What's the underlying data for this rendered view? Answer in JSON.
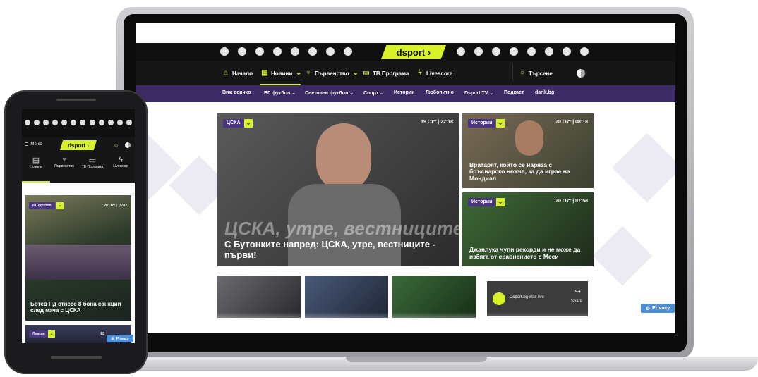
{
  "site": {
    "brand": "dsport",
    "nav": [
      {
        "label": "Начало",
        "icon": "home-icon"
      },
      {
        "label": "Новини",
        "icon": "news-icon"
      },
      {
        "label": "Първенство",
        "icon": "trophy-icon"
      },
      {
        "label": "ТВ Програма",
        "icon": "tv-icon"
      },
      {
        "label": "Livescore",
        "icon": "bolt-icon"
      }
    ],
    "search_label": "Търсене",
    "subnav": [
      "Виж всичко",
      "БГ футбол ⌄",
      "Световен футбол ⌄",
      "Спорт ⌄",
      "Истории",
      "Любопитно",
      "Dsport TV ⌄",
      "Подкаст",
      "darik.bg"
    ],
    "hero": {
      "tag": "ЦСКА",
      "date": "19 Окт | 22:18",
      "title": "С Бутонките напред: ЦСКА, утре, вестниците - първи!",
      "overlay": "ЦСКА, утре, вестниците - първи!"
    },
    "side_cards": [
      {
        "tag": "Истории",
        "date": "20 Окт | 08:18",
        "title": "Вратарят, който се наряза с бръснарско ножче, за да играе на Мондиал"
      },
      {
        "tag": "Истории",
        "date": "20 Окт | 07:58",
        "title": "Джанлука чупи рекорди и не може да избяга от сравнението с Меси"
      }
    ],
    "live_widget": {
      "text": "Dsport.bg was live",
      "share": "Share"
    },
    "privacy": "Privacy"
  },
  "phone": {
    "menu_label": "Меню",
    "brand": "dsport",
    "tabs": [
      {
        "label": "Новини",
        "icon": "news-icon"
      },
      {
        "label": "Първенство",
        "icon": "trophy-icon"
      },
      {
        "label": "ТВ Програма",
        "icon": "tv-icon"
      },
      {
        "label": "Livescore",
        "icon": "bolt-icon"
      }
    ],
    "card": {
      "tag": "БГ футбол",
      "date": "20 Окт | 15:02",
      "title": "Ботев Пд отнесе 8 бона санкции след мача с ЦСКА"
    },
    "card2": {
      "tag": "Левски",
      "date": "20"
    },
    "privacy": "Privacy"
  },
  "colors": {
    "accent": "#d8f22a",
    "purple": "#3b2a63",
    "tag_purple": "#4b3580",
    "privacy_blue": "#4e8fd9"
  }
}
